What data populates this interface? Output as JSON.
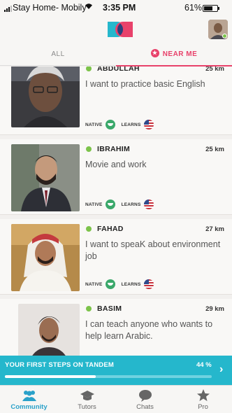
{
  "status_bar": {
    "carrier": "Stay Home- Mobily",
    "wifi_icon": "wifi-icon",
    "time": "3:35 PM",
    "battery": "61%"
  },
  "header": {
    "logo_icon": "tandem-logo",
    "avatar_icon": "user-avatar"
  },
  "tabs": [
    {
      "label": "ALL"
    },
    {
      "label": "NEAR ME",
      "icon": "star-icon"
    }
  ],
  "labels": {
    "native": "NATIVE",
    "learns": "LEARNS"
  },
  "users": [
    {
      "name": "ABDULLAH",
      "distance": "25 km",
      "about": "I want to practice basic English"
    },
    {
      "name": "IBRAHIM",
      "distance": "25 km",
      "about": "Movie and work"
    },
    {
      "name": "FAHAD",
      "distance": "27 km",
      "about": "I want to speaK about environment job"
    },
    {
      "name": "BASIM",
      "distance": "29 km",
      "about": "I can teach anyone who wants to help learn Arabic."
    }
  ],
  "progress": {
    "title": "YOUR FIRST STEPS ON TANDEM",
    "percent_text": "44 %",
    "value": 0.44,
    "chevron": "›"
  },
  "nav": [
    {
      "label": "Community",
      "icon": "community-icon"
    },
    {
      "label": "Tutors",
      "icon": "graduation-cap-icon"
    },
    {
      "label": "Chats",
      "icon": "chat-bubble-icon"
    },
    {
      "label": "Pro",
      "icon": "star-icon"
    }
  ],
  "colors": {
    "accent_pink": "#e8416a",
    "accent_teal": "#25b7cc",
    "online_green": "#7cc34a",
    "nav_active": "#2aa1c9"
  }
}
